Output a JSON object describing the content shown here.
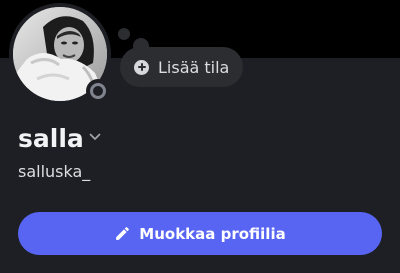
{
  "profile": {
    "display_name": "salla",
    "username": "salluska_",
    "status": "offline"
  },
  "status_prompt": {
    "label": "Lisää tila",
    "icon": "plus-circle-icon"
  },
  "actions": {
    "edit_profile_label": "Muokkaa profiilia",
    "edit_profile_icon": "pencil-icon"
  },
  "colors": {
    "background": "#1e1f24",
    "banner": "#000000",
    "accent": "#5865f2",
    "status_offline": "#80848e"
  }
}
